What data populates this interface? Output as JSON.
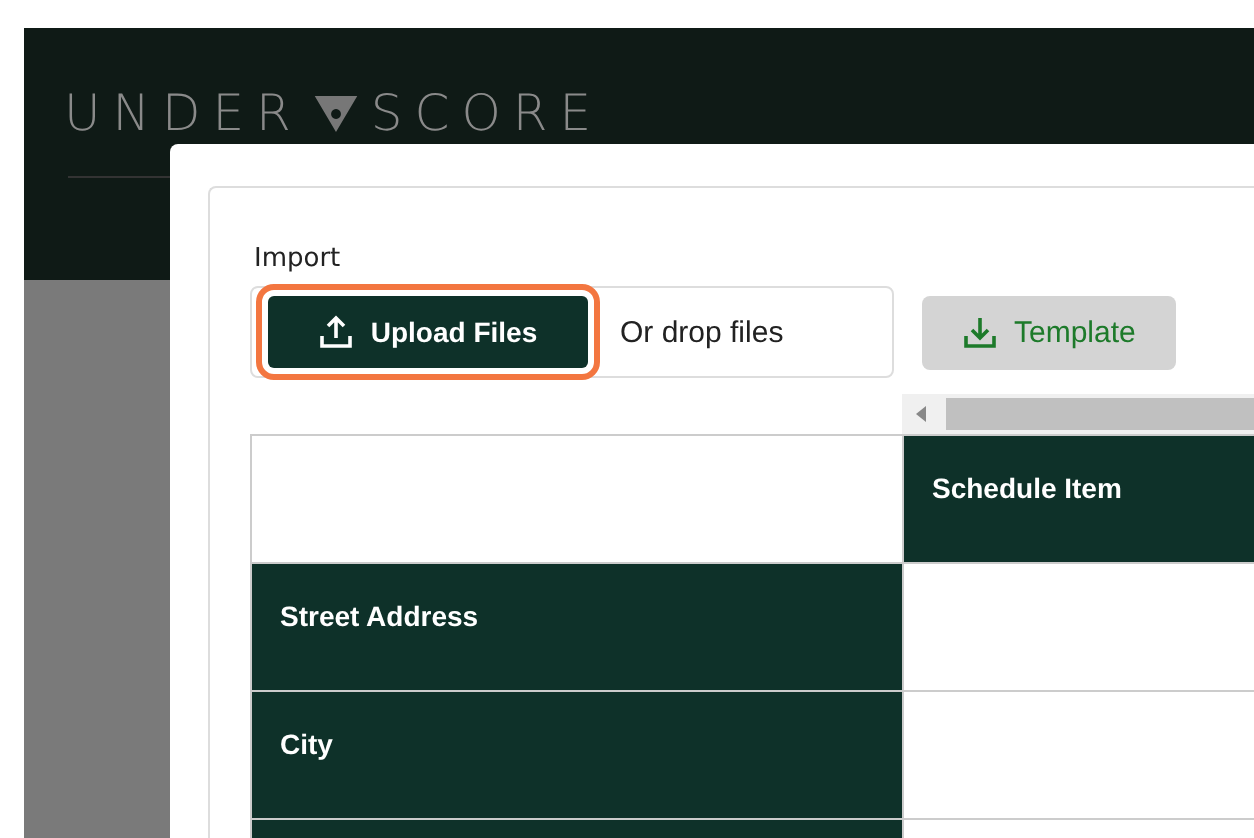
{
  "logo": {
    "left_text": "UNDER",
    "right_text": "SCORE"
  },
  "import": {
    "label": "Import",
    "upload_button": {
      "label": "Upload Files",
      "focused": true
    },
    "drop_hint": "Or drop files",
    "template_button": {
      "label": "Template"
    }
  },
  "table": {
    "columns": [
      {
        "label": "Schedule Item"
      }
    ],
    "rows": [
      {
        "label": "Street Address"
      },
      {
        "label": "City"
      }
    ]
  }
}
